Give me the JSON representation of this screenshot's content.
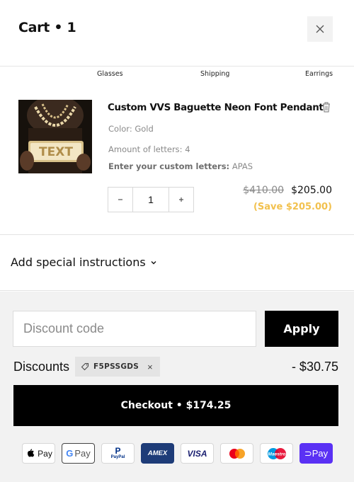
{
  "header": {
    "title": "Cart • 1",
    "close_icon": "close-icon"
  },
  "categories": [
    "Glasses",
    "Shipping",
    "Earrings"
  ],
  "item": {
    "image_alt": "pendant-image",
    "image_text": "TEXT",
    "title": "Custom VVS Baguette Neon Font Pendant",
    "color_label": "Color: Gold",
    "letters_label": "Amount of letters: 4",
    "custom_key": "Enter your custom letters:",
    "custom_value": "APAS",
    "quantity": "1",
    "price_old": "$410.00",
    "price_new": "$205.00",
    "savings": "(Save $205.00)",
    "savings_color": "#f2c14e"
  },
  "special_instructions": {
    "label": "Add special instructions"
  },
  "discount": {
    "placeholder": "Discount code",
    "apply_label": "Apply",
    "discounts_label": "Discounts",
    "code": "F5PSSGDS",
    "amount": "- $30.75"
  },
  "checkout": {
    "label": "Checkout • $174.25"
  },
  "payment_methods": [
    {
      "name": "apple-pay-icon",
      "label": "Pay"
    },
    {
      "name": "google-pay-icon",
      "label": "Pay"
    },
    {
      "name": "paypal-icon",
      "label": "PayPal"
    },
    {
      "name": "amex-icon",
      "label": "AMEX"
    },
    {
      "name": "visa-icon",
      "label": "VISA"
    },
    {
      "name": "mastercard-icon",
      "label": ""
    },
    {
      "name": "maestro-icon",
      "label": "Maestro"
    },
    {
      "name": "opay-icon",
      "label": "Pay"
    }
  ]
}
